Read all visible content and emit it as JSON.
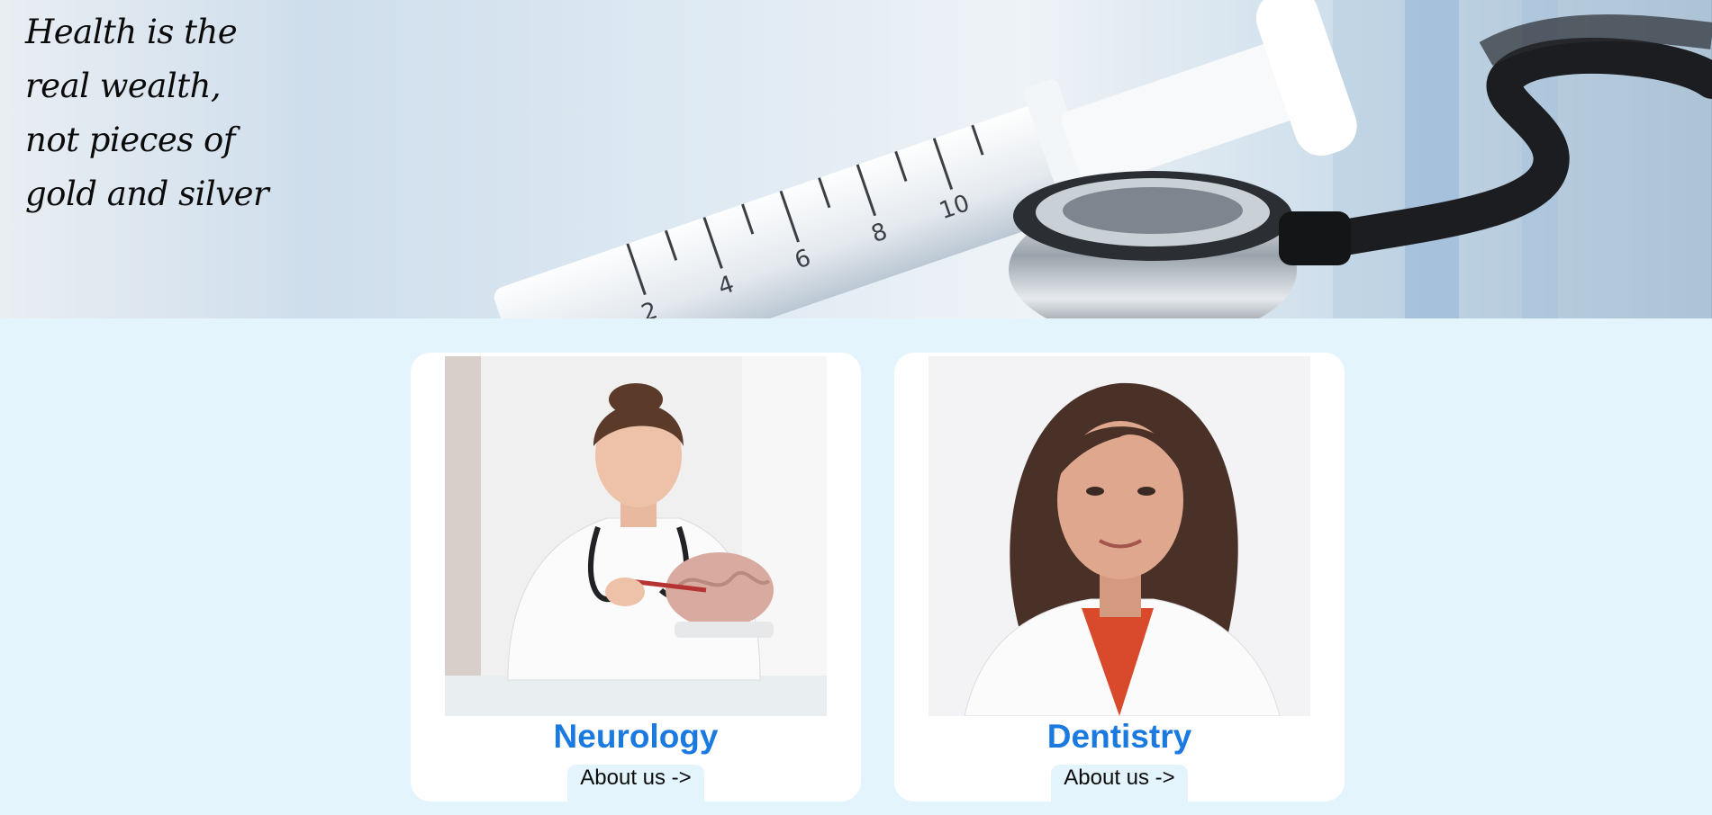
{
  "hero": {
    "quote_lines": [
      "Health is the",
      "real wealth,",
      "not pieces of",
      "gold and silver"
    ]
  },
  "cards": [
    {
      "title": "Neurology",
      "link_label": "About us ->"
    },
    {
      "title": "Dentistry",
      "link_label": "About us ->"
    }
  ],
  "colors": {
    "page_bg": "#e3f4fd",
    "card_bg": "#ffffff",
    "title_accent": "#1b7adf"
  }
}
